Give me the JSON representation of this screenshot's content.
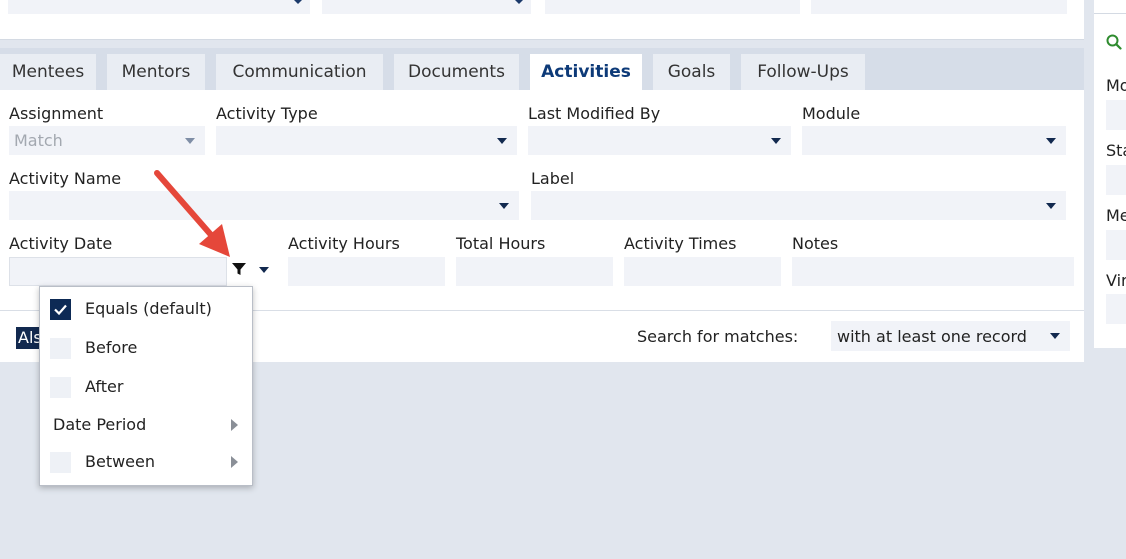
{
  "tabs": [
    {
      "label": "Mentees",
      "active": false
    },
    {
      "label": "Mentors",
      "active": false
    },
    {
      "label": "Communication",
      "active": false
    },
    {
      "label": "Documents",
      "active": false
    },
    {
      "label": "Activities",
      "active": true
    },
    {
      "label": "Goals",
      "active": false
    },
    {
      "label": "Follow-Ups",
      "active": false
    }
  ],
  "form": {
    "assignment": {
      "label": "Assignment",
      "value": "Match"
    },
    "activity_type": {
      "label": "Activity Type",
      "value": ""
    },
    "last_modified_by": {
      "label": "Last Modified By",
      "value": ""
    },
    "module": {
      "label": "Module",
      "value": ""
    },
    "activity_name": {
      "label": "Activity Name",
      "value": ""
    },
    "label_field": {
      "label": "Label",
      "value": ""
    },
    "activity_date": {
      "label": "Activity Date",
      "value": ""
    },
    "activity_hours": {
      "label": "Activity Hours",
      "value": ""
    },
    "total_hours": {
      "label": "Total Hours",
      "value": ""
    },
    "activity_times": {
      "label": "Activity Times",
      "value": ""
    },
    "notes": {
      "label": "Notes",
      "value": ""
    }
  },
  "also_button": {
    "label": "Als"
  },
  "search_matches": {
    "label": "Search for matches:",
    "value": "with at least one record"
  },
  "date_filter_menu": {
    "items": [
      {
        "label": "Equals (default)",
        "checked": true,
        "checkbox": true,
        "submenu": false
      },
      {
        "label": "Before",
        "checked": false,
        "checkbox": true,
        "submenu": false
      },
      {
        "label": "After",
        "checked": false,
        "checkbox": true,
        "submenu": false
      },
      {
        "label": "Date Period",
        "checked": false,
        "checkbox": false,
        "submenu": true
      },
      {
        "label": "Between",
        "checked": false,
        "checkbox": true,
        "submenu": true
      }
    ]
  },
  "right_panel": {
    "labels": [
      "Mo",
      "Sta",
      "Me",
      "Vir"
    ]
  },
  "colors": {
    "accent": "#0d3a78",
    "tab_bar": "#d6dde8",
    "field_bg": "#f1f3f8",
    "annotation_arrow": "#e5473a"
  }
}
